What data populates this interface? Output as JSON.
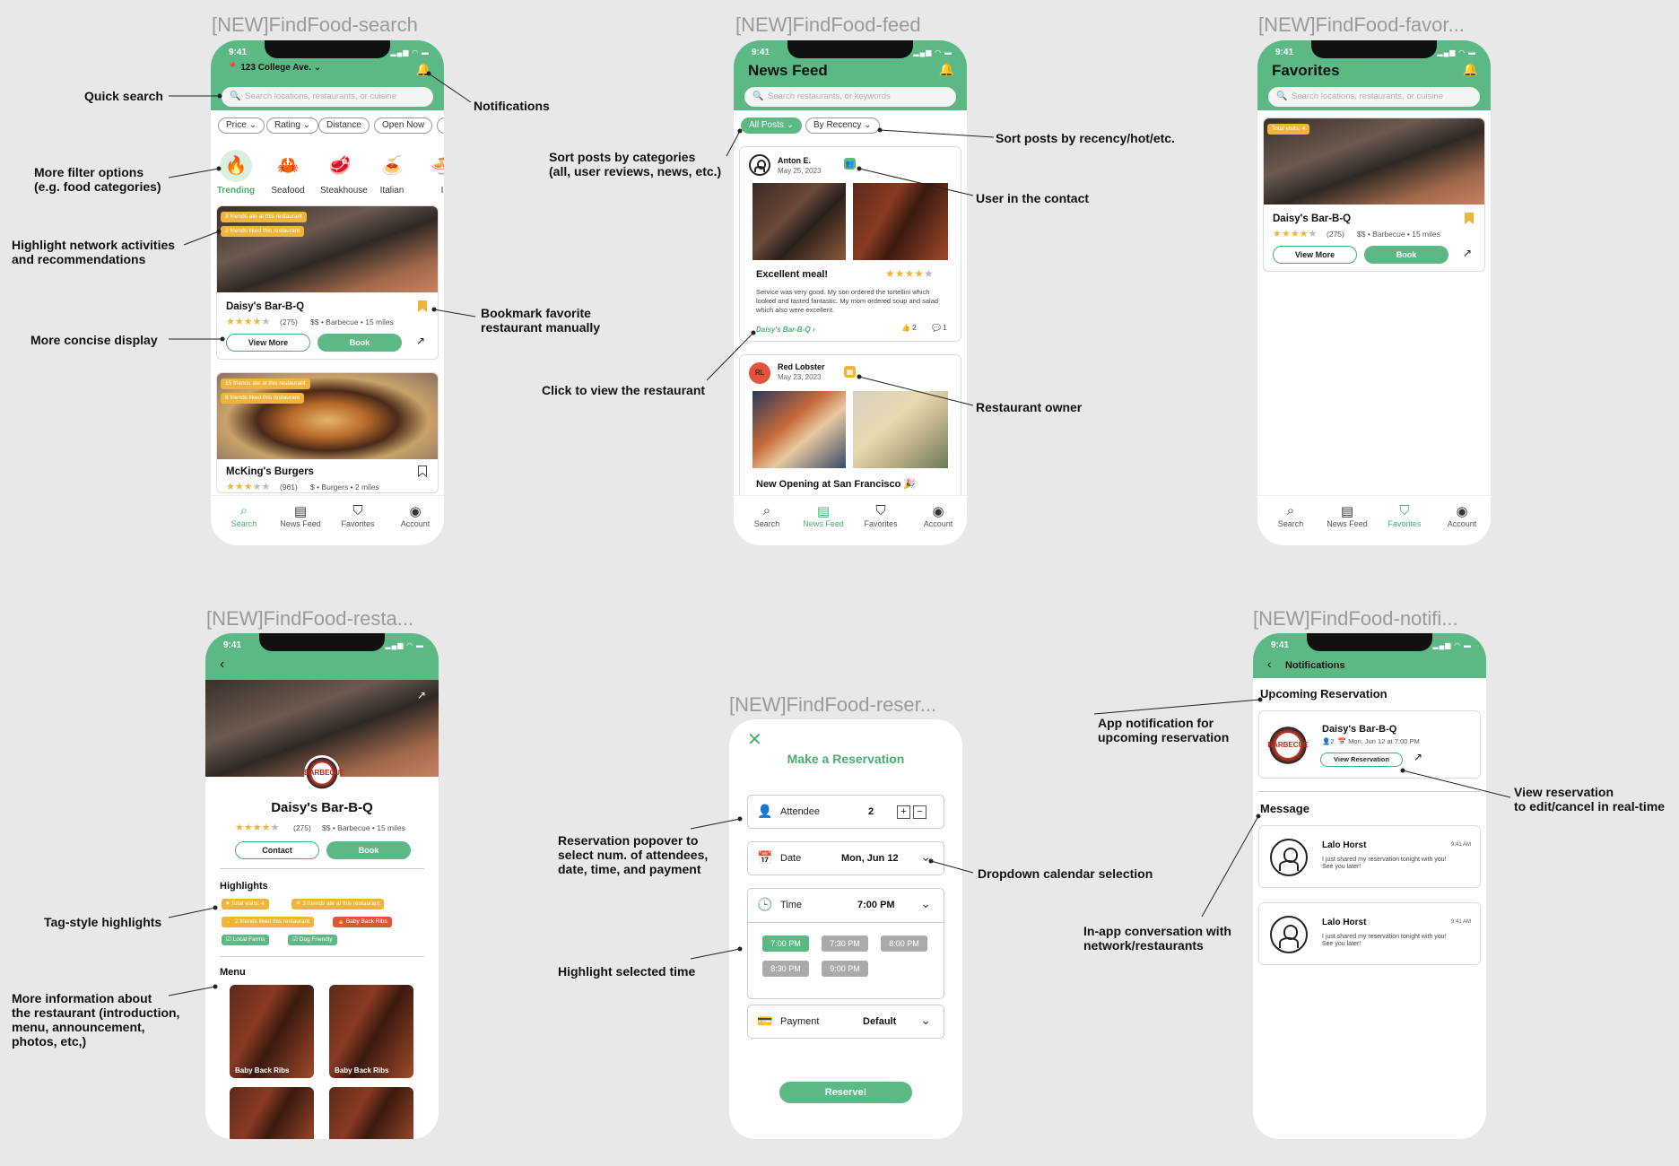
{
  "frames": {
    "search": "[NEW]FindFood-search",
    "feed": "[NEW]FindFood-feed",
    "favorites": "[NEW]FindFood-favor...",
    "restaurant": "[NEW]FindFood-resta...",
    "reservation": "[NEW]FindFood-reser...",
    "notifications": "[NEW]FindFood-notifi..."
  },
  "status_time": "9:41",
  "tabs": [
    "Search",
    "News Feed",
    "Favorites",
    "Account"
  ],
  "search_screen": {
    "location": "123 College Ave.",
    "search_placeholder": "Search locations, restaurants, or cuisine",
    "filters": [
      "Price",
      "Rating",
      "Distance",
      "Open Now",
      "F"
    ],
    "categories": [
      "Trending",
      "Seafood",
      "Steakhouse",
      "Italian",
      "I"
    ],
    "cards": [
      {
        "tags": [
          "3 friends ate at this restaurant",
          "2 friends liked this restaurant"
        ],
        "name": "Daisy's Bar-B-Q",
        "reviews": "(275)",
        "meta": "$$ • Barbecue • 15 miles",
        "rating": 4,
        "view_more": "View More",
        "book": "Book"
      },
      {
        "tags": [
          "15 friends ate at this restaurant",
          "8 friends liked this restaurant"
        ],
        "name": "McKing's Burgers",
        "reviews": "(961)",
        "meta": "$ • Burgers • 2 miles",
        "rating": 3
      }
    ]
  },
  "feed_screen": {
    "title": "News Feed",
    "search_placeholder": "Search restaurants, or keywords",
    "sort_all": "All Posts",
    "sort_recency": "By Recency",
    "posts": [
      {
        "author": "Anton E.",
        "date": "May 25, 2023",
        "title": "Excellent meal!",
        "rating": 4,
        "body": "Service was very good. My son ordered the tortellini which looked and tasted fantastic. My mom ordered soup and salad which also were excellent.",
        "link": "Daisy's Bar-B-Q",
        "likes": "2",
        "comments": "1"
      },
      {
        "author": "Red Lobster",
        "initials": "RL",
        "date": "May 23, 2023",
        "title": "New Opening at San Francisco 🎉"
      }
    ]
  },
  "favorites_screen": {
    "title": "Favorites",
    "search_placeholder": "Search locations, restaurants, or cuisine",
    "tag": "Total visits: 4",
    "name": "Daisy's Bar-B-Q",
    "reviews": "(275)",
    "meta": "$$ • Barbecue • 15 miles",
    "rating": 4,
    "view_more": "View More",
    "book": "Book"
  },
  "restaurant_screen": {
    "name": "Daisy's Bar-B-Q",
    "reviews": "(275)",
    "meta": "$$ • Barbecue • 15 miles",
    "rating": 4,
    "contact": "Contact",
    "book": "Book",
    "highlights_label": "Highlights",
    "highlights": [
      "Total visits: 4",
      "3 friends ate at this restaurant",
      "2 friends liked this restaurant",
      "Baby Back Ribs",
      "Local Farms",
      "Dog Friendly"
    ],
    "menu_label": "Menu",
    "menu_items": [
      "Baby Back Ribs",
      "Baby Back Ribs",
      "",
      ""
    ],
    "logo_text": "BARBECUE"
  },
  "reservation_screen": {
    "title": "Make a Reservation",
    "attendee_label": "Attendee",
    "attendee_value": "2",
    "date_label": "Date",
    "date_value": "Mon, Jun 12",
    "time_label": "Time",
    "time_value": "7:00 PM",
    "times": [
      "7:00 PM",
      "7:30 PM",
      "8:00 PM",
      "8:30 PM",
      "9:00 PM"
    ],
    "payment_label": "Payment",
    "payment_value": "Default",
    "reserve": "Reserve!"
  },
  "notifications_screen": {
    "title": "Notifications",
    "upcoming_label": "Upcoming Reservation",
    "res_name": "Daisy's Bar-B-Q",
    "res_people": "2",
    "res_when": "Mon, Jun 12 at 7:00 PM",
    "view_reservation": "View Reservation",
    "message_label": "Message",
    "messages": [
      {
        "name": "Lalo Horst",
        "time": "9:41 AM",
        "text": "I just shared my reservation tonight with you! See you later!"
      },
      {
        "name": "Lalo Horst",
        "time": "9:41 AM",
        "text": "I just shared my reservation tonight with you! See you later!"
      }
    ]
  },
  "annotations": {
    "quick_search": "Quick search",
    "notifications": "Notifications",
    "more_filter": "More filter options\n(e.g. food categories)",
    "highlight_network": "Highlight network activities\nand recommendations",
    "bookmark": "Bookmark favorite\nrestaurant manually",
    "concise": "More concise display",
    "sort_categories": "Sort posts by categories\n(all, user reviews, news, etc.)",
    "sort_recency": "Sort posts by recency/hot/etc.",
    "user_contact": "User in the contact",
    "click_view": "Click to view the restaurant",
    "restaurant_owner": "Restaurant owner",
    "tag_highlights": "Tag-style highlights",
    "more_info": "More information about\nthe restaurant (introduction,\nmenu, announcement,\nphotos, etc,)",
    "reservation_popover": "Reservation popover to\nselect num. of attendees,\ndate, time, and payment",
    "dropdown_calendar": "Dropdown calendar selection",
    "highlight_time": "Highlight selected time",
    "app_notification": "App notification for\nupcoming reservation",
    "view_reservation_ann": "View reservation\nto edit/cancel in real-time",
    "in_app_conv": "In-app conversation with\nnetwork/restaurants"
  },
  "colors": {
    "accent": "#5cb985",
    "star": "#f0b43c",
    "tag_red": "#e0553a"
  }
}
